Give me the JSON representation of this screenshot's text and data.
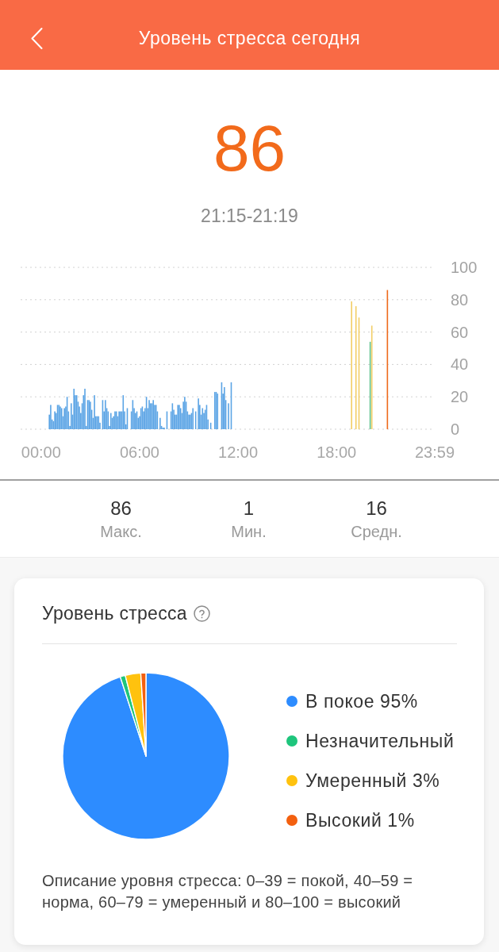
{
  "header": {
    "title": "Уровень стресса сегодня"
  },
  "current": {
    "value": "86",
    "time_range": "21:15-21:19"
  },
  "day_chart": {
    "chart_data": {
      "type": "bar",
      "grid": true,
      "x": [
        30,
        35,
        40,
        45,
        50,
        55,
        60,
        65,
        70,
        75,
        80,
        85,
        90,
        95,
        100,
        105,
        110,
        115,
        120,
        125,
        130,
        135,
        140,
        145,
        150,
        155,
        160,
        165,
        170,
        175,
        180,
        185,
        190,
        195,
        200,
        205,
        210,
        215,
        225,
        230,
        235,
        240,
        245,
        250,
        255,
        260,
        265,
        270,
        275,
        280,
        285,
        290,
        295,
        300,
        305,
        310,
        315,
        330,
        335,
        340,
        345,
        350,
        355,
        360,
        365,
        370,
        375,
        380,
        385,
        390,
        395,
        400,
        405,
        410,
        415,
        420,
        425,
        435,
        440,
        445,
        450,
        460,
        475,
        480,
        485,
        490,
        495,
        500,
        505,
        510,
        515,
        520,
        525,
        530,
        535,
        540,
        545,
        550,
        555,
        565,
        575,
        580,
        585,
        590,
        595,
        600,
        605,
        610,
        620,
        635,
        640,
        645,
        660,
        665,
        670,
        675,
        685,
        695,
        1135,
        1151,
        1162,
        1203,
        1209,
        1266
      ],
      "series": [
        {
          "color": "#5ba4e5",
          "values": [
            9,
            15,
            6,
            5,
            11,
            10,
            15,
            15,
            14,
            13,
            8,
            13,
            14,
            20,
            11,
            2,
            16,
            9,
            25,
            21,
            21,
            17,
            14,
            10,
            16,
            21,
            25,
            2,
            18,
            18,
            17,
            12,
            7,
            21,
            8,
            8,
            8,
            4,
            18,
            11,
            18,
            13,
            11,
            2,
            10,
            7,
            8,
            11,
            11,
            8,
            11,
            11,
            11,
            21,
            11,
            3,
            13,
            11,
            18,
            13,
            10,
            11,
            7,
            8,
            13,
            14,
            11,
            13,
            20,
            13,
            18,
            16,
            16,
            18,
            15,
            15,
            11,
            7,
            2,
            1,
            1,
            11,
            11,
            16,
            12,
            9,
            9,
            15,
            15,
            13,
            10,
            17,
            20,
            17,
            11,
            9,
            9,
            10,
            13,
            11,
            19,
            15,
            9,
            13,
            10,
            12,
            15,
            6,
            4,
            23,
            23,
            22,
            29,
            22,
            26,
            18,
            16,
            29,
            null,
            null,
            null,
            null,
            null,
            null
          ]
        },
        {
          "color": "#5cc08a",
          "values": [
            null,
            null,
            null,
            null,
            null,
            null,
            null,
            null,
            null,
            null,
            null,
            null,
            null,
            null,
            null,
            null,
            null,
            null,
            null,
            null,
            null,
            null,
            null,
            null,
            null,
            null,
            null,
            null,
            null,
            null,
            null,
            null,
            null,
            null,
            null,
            null,
            null,
            null,
            null,
            null,
            null,
            null,
            null,
            null,
            null,
            null,
            null,
            null,
            null,
            null,
            null,
            null,
            null,
            null,
            null,
            null,
            null,
            null,
            null,
            null,
            null,
            null,
            null,
            null,
            null,
            null,
            null,
            null,
            null,
            null,
            null,
            null,
            null,
            null,
            null,
            null,
            null,
            null,
            null,
            null,
            null,
            null,
            null,
            null,
            null,
            null,
            null,
            null,
            null,
            null,
            null,
            null,
            null,
            null,
            null,
            null,
            null,
            null,
            null,
            null,
            null,
            null,
            null,
            null,
            null,
            null,
            null,
            null,
            null,
            null,
            null,
            null,
            null,
            null,
            null,
            null,
            null,
            null,
            null,
            null,
            null,
            54,
            null,
            null
          ]
        },
        {
          "color": "#f2cd66",
          "values": [
            null,
            null,
            null,
            null,
            null,
            null,
            null,
            null,
            null,
            null,
            null,
            null,
            null,
            null,
            null,
            null,
            null,
            null,
            null,
            null,
            null,
            null,
            null,
            null,
            null,
            null,
            null,
            null,
            null,
            null,
            null,
            null,
            null,
            null,
            null,
            null,
            null,
            null,
            null,
            null,
            null,
            null,
            null,
            null,
            null,
            null,
            null,
            null,
            null,
            null,
            null,
            null,
            null,
            null,
            null,
            null,
            null,
            null,
            null,
            null,
            null,
            null,
            null,
            null,
            null,
            null,
            null,
            null,
            null,
            null,
            null,
            null,
            null,
            null,
            null,
            null,
            null,
            null,
            null,
            null,
            null,
            null,
            null,
            null,
            null,
            null,
            null,
            null,
            null,
            null,
            null,
            null,
            null,
            null,
            null,
            null,
            null,
            null,
            null,
            null,
            null,
            null,
            null,
            null,
            null,
            null,
            null,
            null,
            null,
            null,
            null,
            null,
            null,
            null,
            null,
            null,
            null,
            null,
            79,
            76,
            69,
            null,
            64,
            null
          ]
        },
        {
          "color": "#ee6a1c",
          "values": [
            null,
            null,
            null,
            null,
            null,
            null,
            null,
            null,
            null,
            null,
            null,
            null,
            null,
            null,
            null,
            null,
            null,
            null,
            null,
            null,
            null,
            null,
            null,
            null,
            null,
            null,
            null,
            null,
            null,
            null,
            null,
            null,
            null,
            null,
            null,
            null,
            null,
            null,
            null,
            null,
            null,
            null,
            null,
            null,
            null,
            null,
            null,
            null,
            null,
            null,
            null,
            null,
            null,
            null,
            null,
            null,
            null,
            null,
            null,
            null,
            null,
            null,
            null,
            null,
            null,
            null,
            null,
            null,
            null,
            null,
            null,
            null,
            null,
            null,
            null,
            null,
            null,
            null,
            null,
            null,
            null,
            null,
            null,
            null,
            null,
            null,
            null,
            null,
            null,
            null,
            null,
            null,
            null,
            null,
            null,
            null,
            null,
            null,
            null,
            null,
            null,
            null,
            null,
            null,
            null,
            null,
            null,
            null,
            null,
            null,
            null,
            null,
            null,
            null,
            null,
            null,
            null,
            null,
            null,
            null,
            null,
            null,
            null,
            86
          ]
        }
      ],
      "xlim": [
        -75,
        1439
      ],
      "ylim": [
        0,
        100
      ],
      "xticks": [
        {
          "value": 0,
          "label": "00:00"
        },
        {
          "value": 360,
          "label": "06:00"
        },
        {
          "value": 720,
          "label": "12:00"
        },
        {
          "value": 1080,
          "label": "18:00"
        },
        {
          "value": 1439,
          "label": "23:59"
        }
      ],
      "yticks": [
        0,
        20,
        40,
        60,
        80,
        100
      ]
    }
  },
  "stats": [
    {
      "value": "86",
      "label": "Макс."
    },
    {
      "value": "1",
      "label": "Мин."
    },
    {
      "value": "16",
      "label": "Средн."
    }
  ],
  "stress_breakdown": {
    "title": "Уровень стресса",
    "legend": [
      {
        "label": "В покое 95%",
        "color": "#2d8cff"
      },
      {
        "label": "Незначительный",
        "color": "#1ec57c"
      },
      {
        "label": "Умеренный 3%",
        "color": "#ffc20e"
      },
      {
        "label": "Высокий 1%",
        "color": "#f3600f"
      }
    ],
    "chart_data": {
      "type": "pie",
      "values": [
        95,
        1,
        3,
        1
      ]
    },
    "description": "Описание уровня стресса: 0–39 = покой, 40–59 = норма, 60–79 = умеренный и 80–100 = высокий"
  }
}
